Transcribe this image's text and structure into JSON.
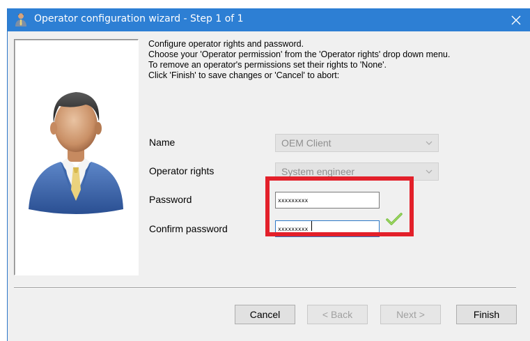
{
  "window": {
    "title": "Operator configuration wizard - Step 1 of 1",
    "accent_color": "#2d7fd4",
    "title_icon": "operator-icon",
    "close_icon": "close-icon"
  },
  "instructions": {
    "line1": "Configure operator rights and password.",
    "line2": "Choose your 'Operator permission' from the 'Operator rights' drop down menu.",
    "line3": "To remove an operator's permissions set their rights to 'None'.",
    "line4": "Click 'Finish' to save changes or 'Cancel' to abort:"
  },
  "form": {
    "name_label": "Name",
    "name_value": "OEM Client",
    "rights_label": "Operator rights",
    "rights_value": "System engineer",
    "password_label": "Password",
    "password_value": "xxxxxxxxx",
    "confirm_label": "Confirm password",
    "confirm_value": "xxxxxxxxx",
    "confirm_status_icon": "checkmark-icon",
    "highlight_color": "#e3202a"
  },
  "buttons": {
    "cancel": "Cancel",
    "back": "< Back",
    "next": "Next >",
    "finish": "Finish"
  }
}
